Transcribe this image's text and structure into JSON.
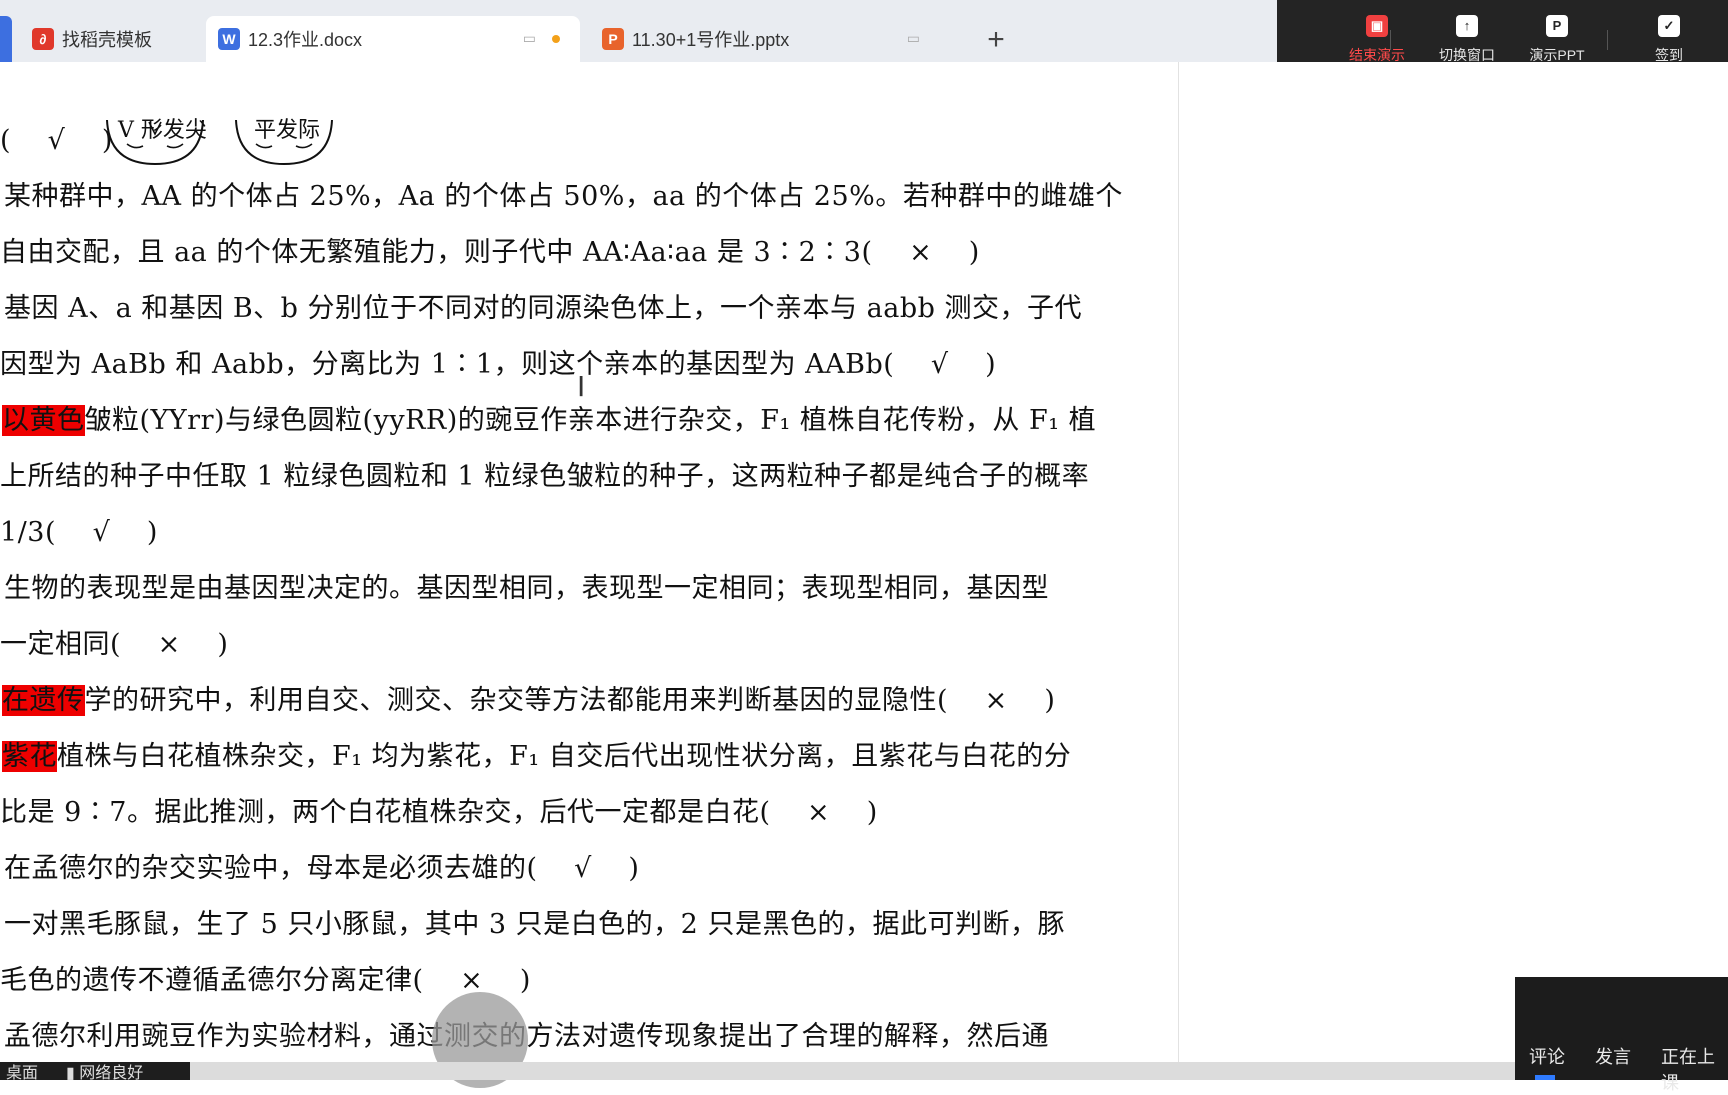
{
  "tabs": [
    {
      "label": "找稻壳模板",
      "icon": "daoke-logo-icon",
      "color": "#e0382b"
    },
    {
      "label": "12.3作业.docx",
      "icon": "word-doc-icon",
      "color": "#3d6fe0",
      "active": true
    },
    {
      "label": "11.30+1号作业.pptx",
      "icon": "ppt-doc-icon",
      "color": "#e8632c"
    }
  ],
  "new_tab_label": "+",
  "presenter_toolbar": {
    "end_show": "结束演示",
    "switch_window": "切换窗口",
    "present_ppt": "演示PPT",
    "sign_in": "签到"
  },
  "document": {
    "face_labels": [
      "V 形发尖",
      "平发际"
    ],
    "lines": [
      {
        "text": "(　 √ 　)",
        "top": 0
      },
      {
        "text": "某种群中，AA 的个体占 25%，Aa 的个体占 50%，aa 的个体占 25%。若种群中的雌雄个"
      },
      {
        "text": "自由交配，且 aa 的个体无繁殖能力，则子代中 AA∶Aa∶aa 是 3∶2∶3(　 ×　 )"
      },
      {
        "text": "基因 A、a 和基因 B、b 分别位于不同对的同源染色体上，一个亲本与 aabb 测交，子代"
      },
      {
        "text": "因型为 AaBb 和 Aabb，分离比为 1∶1，则这个亲本的基因型为 AABb(　 √　 )"
      },
      {
        "highlight": "以黄色",
        "text": "皱粒(YYrr)与绿色圆粒(yyRR)的豌豆作亲本进行杂交，F₁ 植株自花传粉，从 F₁ 植"
      },
      {
        "text": "上所结的种子中任取 1 粒绿色圆粒和 1 粒绿色皱粒的种子，这两粒种子都是纯合子的概率"
      },
      {
        "text": "1/3(　 √　 )"
      },
      {
        "text": "生物的表现型是由基因型决定的。基因型相同，表现型一定相同；表现型相同，基因型"
      },
      {
        "text": "一定相同(　 ×　 )"
      },
      {
        "highlight": "在遗传",
        "text": "学的研究中，利用自交、测交、杂交等方法都能用来判断基因的显隐性(　 ×　 )"
      },
      {
        "highlight": "紫花",
        "text": "植株与白花植株杂交，F₁ 均为紫花，F₁ 自交后代出现性状分离，且紫花与白花的分"
      },
      {
        "text": "比是 9∶7。据此推测，两个白花植株杂交，后代一定都是白花(　 ×　 )"
      },
      {
        "text": "在孟德尔的杂交实验中，母本是必须去雄的(　 √　 )"
      },
      {
        "text": "一对黑毛豚鼠，生了 5 只小豚鼠，其中 3 只是白色的，2 只是黑色的，据此可判断，豚"
      },
      {
        "text": "毛色的遗传不遵循孟德尔分离定律(　 ×　 )"
      },
      {
        "text": "孟德尔利用豌豆作为实验材料，通过测交的方法对遗传现象提出了合理的解释，然后通"
      }
    ]
  },
  "status": {
    "desktop": "桌面",
    "network": "网络良好"
  },
  "chat_tabs": [
    "评论",
    "发言",
    "正在上课"
  ],
  "colors": {
    "highlight": "#ee0000",
    "presenter_bg": "#242424",
    "end_show_red": "#f04040",
    "tabbar_bg": "#e9ecf1"
  }
}
